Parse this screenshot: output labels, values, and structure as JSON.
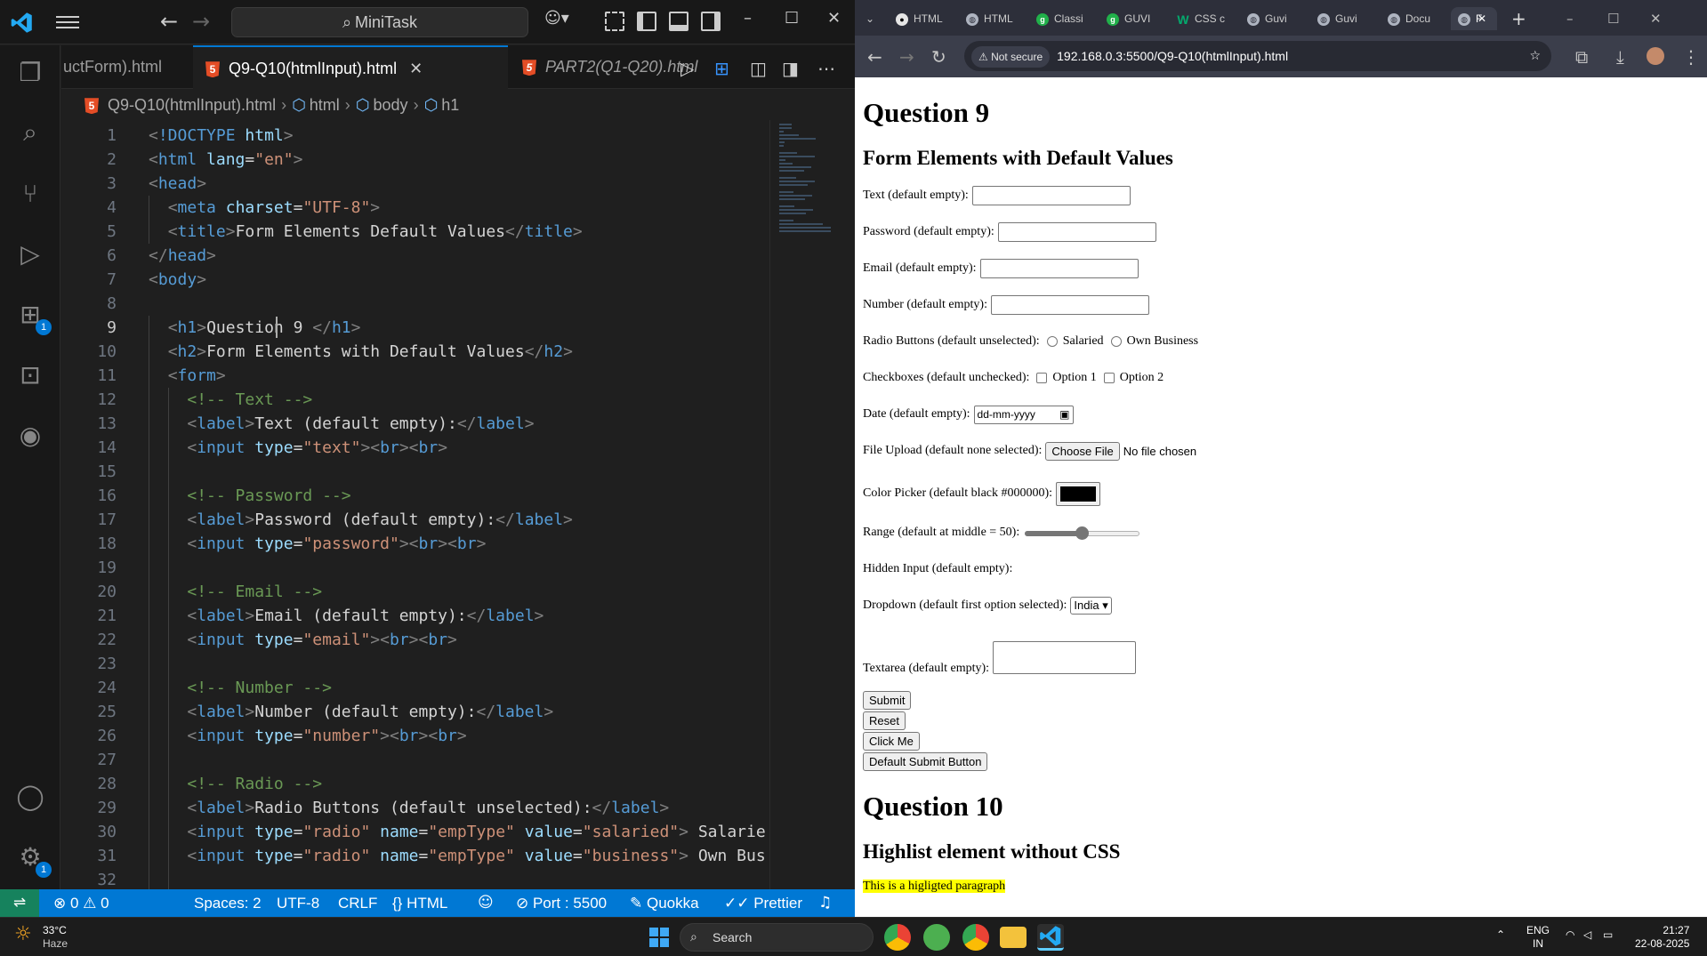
{
  "vscode": {
    "search_text": "MiniTask",
    "tabs": [
      {
        "label": "uctForm).html",
        "italic": false,
        "active": false
      },
      {
        "label": "Q9-Q10(htmlInput).html",
        "italic": false,
        "active": true
      },
      {
        "label": "PART2(Q1-Q20).html",
        "italic": true,
        "active": false
      }
    ],
    "breadcrumb": [
      "Q9-Q10(htmlInput).html",
      "html",
      "body",
      "h1"
    ],
    "activity_badges": {
      "extensions": "1",
      "settings": "1"
    },
    "code_lines": [
      {
        "n": "1",
        "tokens": [
          [
            "t",
            "<"
          ],
          [
            "tn",
            "!DOCTYPE"
          ],
          [
            "tx",
            " "
          ],
          [
            "an",
            "html"
          ],
          [
            "t",
            ">"
          ]
        ]
      },
      {
        "n": "2",
        "tokens": [
          [
            "t",
            "<"
          ],
          [
            "tn",
            "html"
          ],
          [
            "tx",
            " "
          ],
          [
            "an",
            "lang"
          ],
          [
            "tx",
            "="
          ],
          [
            "av",
            "\"en\""
          ],
          [
            "t",
            ">"
          ]
        ]
      },
      {
        "n": "3",
        "tokens": [
          [
            "t",
            "<"
          ],
          [
            "tn",
            "head"
          ],
          [
            "t",
            ">"
          ]
        ]
      },
      {
        "n": "4",
        "tokens": [
          [
            "tx",
            "  "
          ],
          [
            "t",
            "<"
          ],
          [
            "tn",
            "meta"
          ],
          [
            "tx",
            " "
          ],
          [
            "an",
            "charset"
          ],
          [
            "tx",
            "="
          ],
          [
            "av",
            "\"UTF-8\""
          ],
          [
            "t",
            ">"
          ]
        ]
      },
      {
        "n": "5",
        "tokens": [
          [
            "tx",
            "  "
          ],
          [
            "t",
            "<"
          ],
          [
            "tn",
            "title"
          ],
          [
            "t",
            ">"
          ],
          [
            "tx",
            "Form Elements Default Values"
          ],
          [
            "t",
            "</"
          ],
          [
            "tn",
            "title"
          ],
          [
            "t",
            ">"
          ]
        ]
      },
      {
        "n": "6",
        "tokens": [
          [
            "t",
            "</"
          ],
          [
            "tn",
            "head"
          ],
          [
            "t",
            ">"
          ]
        ]
      },
      {
        "n": "7",
        "tokens": [
          [
            "t",
            "<"
          ],
          [
            "tn",
            "body"
          ],
          [
            "t",
            ">"
          ]
        ]
      },
      {
        "n": "8",
        "tokens": []
      },
      {
        "n": "9",
        "tokens": [
          [
            "tx",
            "  "
          ],
          [
            "t",
            "<"
          ],
          [
            "tn",
            "h1"
          ],
          [
            "t",
            ">"
          ],
          [
            "tx",
            "Question 9 "
          ],
          [
            "t",
            "</"
          ],
          [
            "tn",
            "h1"
          ],
          [
            "t",
            ">"
          ]
        ]
      },
      {
        "n": "10",
        "tokens": [
          [
            "tx",
            "  "
          ],
          [
            "t",
            "<"
          ],
          [
            "tn",
            "h2"
          ],
          [
            "t",
            ">"
          ],
          [
            "tx",
            "Form Elements with Default Values"
          ],
          [
            "t",
            "</"
          ],
          [
            "tn",
            "h2"
          ],
          [
            "t",
            ">"
          ]
        ]
      },
      {
        "n": "11",
        "tokens": [
          [
            "tx",
            "  "
          ],
          [
            "t",
            "<"
          ],
          [
            "tn",
            "form"
          ],
          [
            "t",
            ">"
          ]
        ]
      },
      {
        "n": "12",
        "tokens": [
          [
            "tx",
            "    "
          ],
          [
            "cm",
            "<!-- Text -->"
          ]
        ]
      },
      {
        "n": "13",
        "tokens": [
          [
            "tx",
            "    "
          ],
          [
            "t",
            "<"
          ],
          [
            "tn",
            "label"
          ],
          [
            "t",
            ">"
          ],
          [
            "tx",
            "Text (default empty):"
          ],
          [
            "t",
            "</"
          ],
          [
            "tn",
            "label"
          ],
          [
            "t",
            ">"
          ]
        ]
      },
      {
        "n": "14",
        "tokens": [
          [
            "tx",
            "    "
          ],
          [
            "t",
            "<"
          ],
          [
            "tn",
            "input"
          ],
          [
            "tx",
            " "
          ],
          [
            "an",
            "type"
          ],
          [
            "tx",
            "="
          ],
          [
            "av",
            "\"text\""
          ],
          [
            "t",
            "><"
          ],
          [
            "tn",
            "br"
          ],
          [
            "t",
            "><"
          ],
          [
            "tn",
            "br"
          ],
          [
            "t",
            ">"
          ]
        ]
      },
      {
        "n": "15",
        "tokens": []
      },
      {
        "n": "16",
        "tokens": [
          [
            "tx",
            "    "
          ],
          [
            "cm",
            "<!-- Password -->"
          ]
        ]
      },
      {
        "n": "17",
        "tokens": [
          [
            "tx",
            "    "
          ],
          [
            "t",
            "<"
          ],
          [
            "tn",
            "label"
          ],
          [
            "t",
            ">"
          ],
          [
            "tx",
            "Password (default empty):"
          ],
          [
            "t",
            "</"
          ],
          [
            "tn",
            "label"
          ],
          [
            "t",
            ">"
          ]
        ]
      },
      {
        "n": "18",
        "tokens": [
          [
            "tx",
            "    "
          ],
          [
            "t",
            "<"
          ],
          [
            "tn",
            "input"
          ],
          [
            "tx",
            " "
          ],
          [
            "an",
            "type"
          ],
          [
            "tx",
            "="
          ],
          [
            "av",
            "\"password\""
          ],
          [
            "t",
            "><"
          ],
          [
            "tn",
            "br"
          ],
          [
            "t",
            "><"
          ],
          [
            "tn",
            "br"
          ],
          [
            "t",
            ">"
          ]
        ]
      },
      {
        "n": "19",
        "tokens": []
      },
      {
        "n": "20",
        "tokens": [
          [
            "tx",
            "    "
          ],
          [
            "cm",
            "<!-- Email -->"
          ]
        ]
      },
      {
        "n": "21",
        "tokens": [
          [
            "tx",
            "    "
          ],
          [
            "t",
            "<"
          ],
          [
            "tn",
            "label"
          ],
          [
            "t",
            ">"
          ],
          [
            "tx",
            "Email (default empty):"
          ],
          [
            "t",
            "</"
          ],
          [
            "tn",
            "label"
          ],
          [
            "t",
            ">"
          ]
        ]
      },
      {
        "n": "22",
        "tokens": [
          [
            "tx",
            "    "
          ],
          [
            "t",
            "<"
          ],
          [
            "tn",
            "input"
          ],
          [
            "tx",
            " "
          ],
          [
            "an",
            "type"
          ],
          [
            "tx",
            "="
          ],
          [
            "av",
            "\"email\""
          ],
          [
            "t",
            "><"
          ],
          [
            "tn",
            "br"
          ],
          [
            "t",
            "><"
          ],
          [
            "tn",
            "br"
          ],
          [
            "t",
            ">"
          ]
        ]
      },
      {
        "n": "23",
        "tokens": []
      },
      {
        "n": "24",
        "tokens": [
          [
            "tx",
            "    "
          ],
          [
            "cm",
            "<!-- Number -->"
          ]
        ]
      },
      {
        "n": "25",
        "tokens": [
          [
            "tx",
            "    "
          ],
          [
            "t",
            "<"
          ],
          [
            "tn",
            "label"
          ],
          [
            "t",
            ">"
          ],
          [
            "tx",
            "Number (default empty):"
          ],
          [
            "t",
            "</"
          ],
          [
            "tn",
            "label"
          ],
          [
            "t",
            ">"
          ]
        ]
      },
      {
        "n": "26",
        "tokens": [
          [
            "tx",
            "    "
          ],
          [
            "t",
            "<"
          ],
          [
            "tn",
            "input"
          ],
          [
            "tx",
            " "
          ],
          [
            "an",
            "type"
          ],
          [
            "tx",
            "="
          ],
          [
            "av",
            "\"number\""
          ],
          [
            "t",
            "><"
          ],
          [
            "tn",
            "br"
          ],
          [
            "t",
            "><"
          ],
          [
            "tn",
            "br"
          ],
          [
            "t",
            ">"
          ]
        ]
      },
      {
        "n": "27",
        "tokens": []
      },
      {
        "n": "28",
        "tokens": [
          [
            "tx",
            "    "
          ],
          [
            "cm",
            "<!-- Radio -->"
          ]
        ]
      },
      {
        "n": "29",
        "tokens": [
          [
            "tx",
            "    "
          ],
          [
            "t",
            "<"
          ],
          [
            "tn",
            "label"
          ],
          [
            "t",
            ">"
          ],
          [
            "tx",
            "Radio Buttons (default unselected):"
          ],
          [
            "t",
            "</"
          ],
          [
            "tn",
            "label"
          ],
          [
            "t",
            ">"
          ]
        ]
      },
      {
        "n": "30",
        "tokens": [
          [
            "tx",
            "    "
          ],
          [
            "t",
            "<"
          ],
          [
            "tn",
            "input"
          ],
          [
            "tx",
            " "
          ],
          [
            "an",
            "type"
          ],
          [
            "tx",
            "="
          ],
          [
            "av",
            "\"radio\""
          ],
          [
            "tx",
            " "
          ],
          [
            "an",
            "name"
          ],
          [
            "tx",
            "="
          ],
          [
            "av",
            "\"empType\""
          ],
          [
            "tx",
            " "
          ],
          [
            "an",
            "value"
          ],
          [
            "tx",
            "="
          ],
          [
            "av",
            "\"salaried\""
          ],
          [
            "t",
            ">"
          ],
          [
            "tx",
            " Salarie"
          ]
        ]
      },
      {
        "n": "31",
        "tokens": [
          [
            "tx",
            "    "
          ],
          [
            "t",
            "<"
          ],
          [
            "tn",
            "input"
          ],
          [
            "tx",
            " "
          ],
          [
            "an",
            "type"
          ],
          [
            "tx",
            "="
          ],
          [
            "av",
            "\"radio\""
          ],
          [
            "tx",
            " "
          ],
          [
            "an",
            "name"
          ],
          [
            "tx",
            "="
          ],
          [
            "av",
            "\"empType\""
          ],
          [
            "tx",
            " "
          ],
          [
            "an",
            "value"
          ],
          [
            "tx",
            "="
          ],
          [
            "av",
            "\"business\""
          ],
          [
            "t",
            ">"
          ],
          [
            "tx",
            " Own Bus"
          ]
        ]
      },
      {
        "n": "32",
        "tokens": []
      }
    ],
    "status": {
      "errors": "0",
      "warnings": "0",
      "spaces": "Spaces: 2",
      "encoding": "UTF-8",
      "eol": "CRLF",
      "language": "{} HTML",
      "port": "Port : 5500",
      "quokka": "Quokka",
      "prettier": "Prettier"
    }
  },
  "chrome": {
    "tabs": [
      {
        "label": "HTML",
        "icon": "gh"
      },
      {
        "label": "HTML",
        "icon": "globe"
      },
      {
        "label": "Classi",
        "icon": "guvi"
      },
      {
        "label": "GUVI",
        "icon": "guvi"
      },
      {
        "label": "CSS c",
        "icon": "w3"
      },
      {
        "label": "Guvi",
        "icon": "globe"
      },
      {
        "label": "Guvi",
        "icon": "globe"
      },
      {
        "label": "Docu",
        "icon": "globe"
      },
      {
        "label": "F",
        "icon": "globe"
      }
    ],
    "security_label": "Not secure",
    "url": "192.168.0.3:5500/Q9-Q10(htmlInput).html",
    "page": {
      "h1_q9": "Question 9",
      "h2_q9": "Form Elements with Default Values",
      "text_label": "Text (default empty):",
      "password_label": "Password (default empty):",
      "email_label": "Email (default empty):",
      "number_label": "Number (default empty):",
      "radio_label": "Radio Buttons (default unselected):",
      "radio_opt1": "Salaried",
      "radio_opt2": "Own Business",
      "check_label": "Checkboxes (default unchecked):",
      "check_opt1": "Option 1",
      "check_opt2": "Option 2",
      "date_label": "Date (default empty):",
      "date_placeholder": "dd-mm-yyyy",
      "file_label": "File Upload (default none selected):",
      "file_button": "Choose File",
      "file_status": "No file chosen",
      "color_label": "Color Picker (default black #000000):",
      "color_value": "#000000",
      "range_label": "Range (default at middle = 50):",
      "range_value": 50,
      "hidden_label": "Hidden Input (default empty):",
      "dropdown_label": "Dropdown (default first option selected):",
      "dropdown_value": "India",
      "textarea_label": "Textarea (default empty):",
      "buttons": [
        "Submit",
        "Reset",
        "Click Me",
        "Default Submit Button"
      ],
      "h1_q10": "Question 10",
      "h2_q10": "Highlist element without CSS",
      "highlight_text": "This is a higligted paragraph"
    }
  },
  "taskbar": {
    "weather_temp": "33°C",
    "weather_desc": "Haze",
    "search_text": "Search",
    "lang1": "ENG",
    "lang2": "IN",
    "time": "21:27",
    "date": "22-08-2025"
  }
}
